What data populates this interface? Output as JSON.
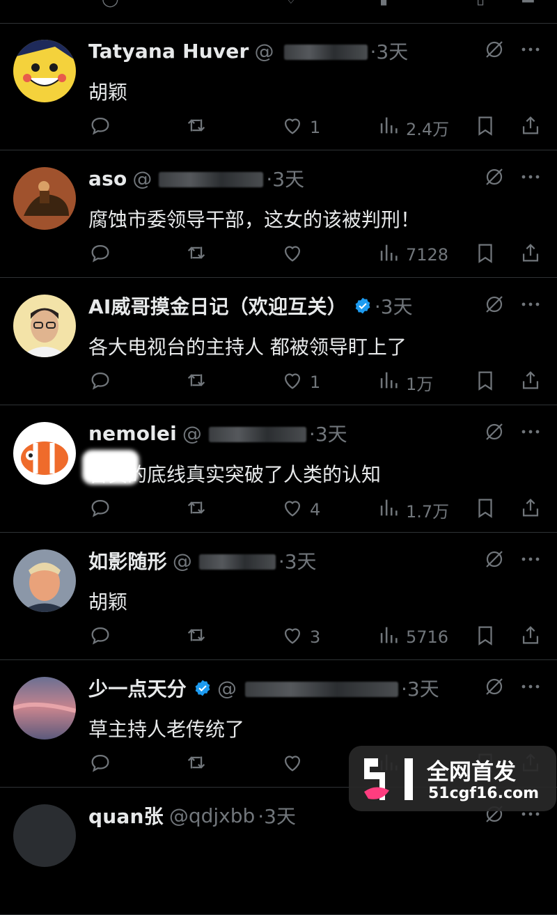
{
  "colors": {
    "background": "#000000",
    "text": "#e7e9ea",
    "muted": "#71767b",
    "divider": "#2f3336",
    "verified": "#1d9bf0"
  },
  "posts": [
    {
      "name": "Tatyana Huver",
      "handle": "@",
      "time": "·3天",
      "verified": false,
      "content": "胡颖",
      "reply": "",
      "retweet": "",
      "like": "1",
      "views": "2.4万",
      "avatar": "pikachu"
    },
    {
      "name": "aso",
      "handle": "@",
      "time": "·3天",
      "verified": false,
      "content": "腐蚀市委领导干部，这女的该被判刑！",
      "reply": "",
      "retweet": "",
      "like": "",
      "views": "7128",
      "avatar": "horse-rider"
    },
    {
      "name": "AI威哥摸金日记（欢迎互关）",
      "handle": "",
      "time": "·3天",
      "verified": true,
      "content": "各大电视台的主持人 都被领导盯上了",
      "reply": "",
      "retweet": "",
      "like": "1",
      "views": "1万",
      "avatar": "man-glasses"
    },
    {
      "name": "nemolei",
      "handle": "@",
      "time": "·3天",
      "verified": false,
      "content": "官员的底线真实突破了人类的认知",
      "reply": "",
      "retweet": "",
      "like": "4",
      "views": "1.7万",
      "avatar": "clownfish"
    },
    {
      "name": "如影随形",
      "handle": "@",
      "time": "·3天",
      "verified": false,
      "content": "胡颖",
      "reply": "",
      "retweet": "",
      "like": "3",
      "views": "5716",
      "avatar": "man-portrait"
    },
    {
      "name": "少一点天分",
      "handle": "@",
      "time": "·3天",
      "verified": true,
      "content": "草主持人老传统了",
      "reply": "",
      "retweet": "",
      "like": "",
      "views": "",
      "avatar": "sunset-sky"
    },
    {
      "name": "quan张",
      "handle": "@qdjxbb",
      "time": "·3天",
      "verified": false,
      "content": "",
      "reply": "",
      "retweet": "",
      "like": "",
      "views": "",
      "avatar": ""
    }
  ],
  "icons": {
    "reply": "reply-icon",
    "retweet": "retweet-icon",
    "like": "like-icon",
    "views": "views-icon",
    "bookmark": "bookmark-icon",
    "share": "share-icon",
    "grok": "grok-icon",
    "more": "more-icon"
  },
  "watermark": {
    "line1": "全网首发",
    "line2": "51cgf16.com",
    "logo_text": "51"
  }
}
